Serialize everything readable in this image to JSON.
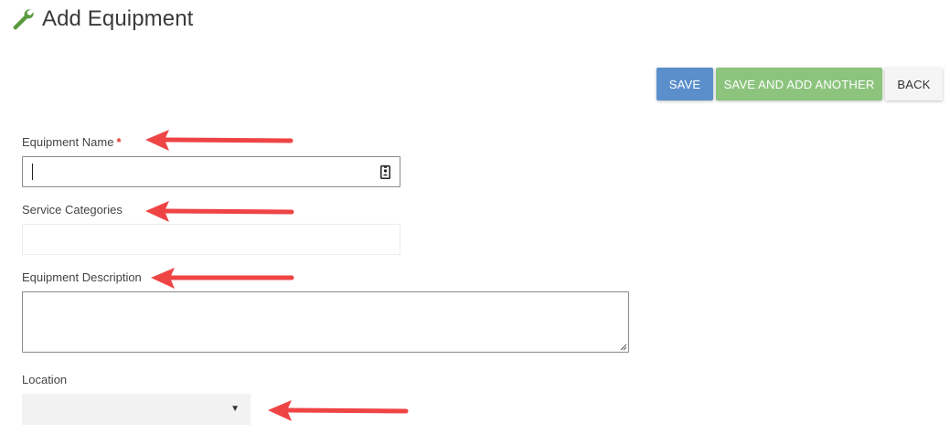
{
  "header": {
    "title": "Add Equipment",
    "icon": "wrench-icon",
    "icon_color": "#5a9a3c"
  },
  "toolbar": {
    "save_label": "SAVE",
    "save_add_label": "SAVE AND ADD ANOTHER",
    "back_label": "BACK",
    "save_color": "#5b8fcc",
    "save_add_color": "#8cc47e",
    "back_color": "#f5f5f5"
  },
  "form": {
    "equipment_name": {
      "label": "Equipment Name",
      "required_marker": "*",
      "value": "",
      "icon": "contact-card-icon"
    },
    "service_categories": {
      "label": "Service Categories",
      "value": ""
    },
    "equipment_description": {
      "label": "Equipment Description",
      "value": ""
    },
    "location": {
      "label": "Location",
      "selected": "",
      "icon": "dropdown-triangle-icon"
    }
  },
  "annotations": {
    "arrow_color": "#ef4444",
    "arrow_icon": "red-arrow-icon"
  }
}
